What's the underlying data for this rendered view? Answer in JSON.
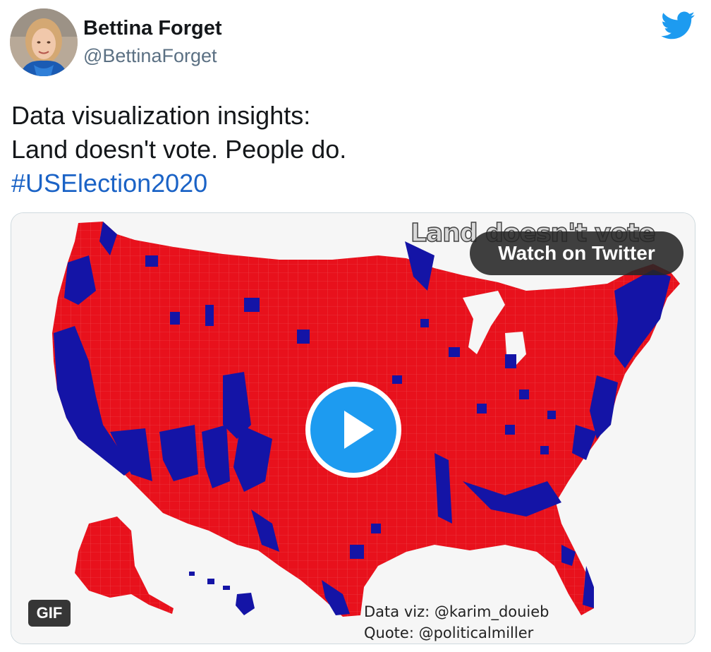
{
  "author": {
    "name": "Bettina Forget",
    "handle": "@BettinaForget",
    "avatar_icon": "profile-photo"
  },
  "tweet": {
    "lines": [
      "Data visualization insights:",
      "Land doesn't vote. People do."
    ],
    "hashtag": "#USElection2020"
  },
  "media": {
    "type": "GIF",
    "overlay_title": "Land doesn't vote",
    "watch_label": "Watch on Twitter",
    "gif_label": "GIF",
    "credit_line_1": "Data viz: @karim_douieb",
    "credit_line_2": "Quote: @politicalmiller",
    "colors": {
      "republican": "#e8111c",
      "democrat": "#1414a6",
      "play_button": "#1d9bf0",
      "twitter_brand": "#1d9bf0",
      "hashtag": "#1b63c6"
    }
  }
}
